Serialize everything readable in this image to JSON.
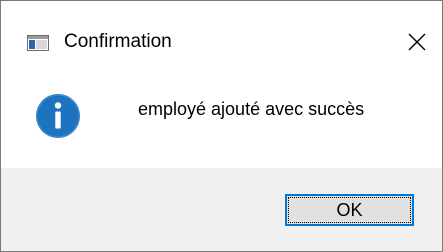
{
  "window": {
    "title": "Confirmation",
    "app_icon": "window-icon",
    "close_icon": "close-icon"
  },
  "content": {
    "icon": "info-icon",
    "message": "employé ajouté avec succès"
  },
  "buttons": {
    "ok_label": "OK"
  },
  "colors": {
    "info_blue": "#1e73be",
    "focus_border": "#0078d7",
    "footer_bg": "#f0f0f0",
    "button_bg": "#e1e1e1"
  }
}
